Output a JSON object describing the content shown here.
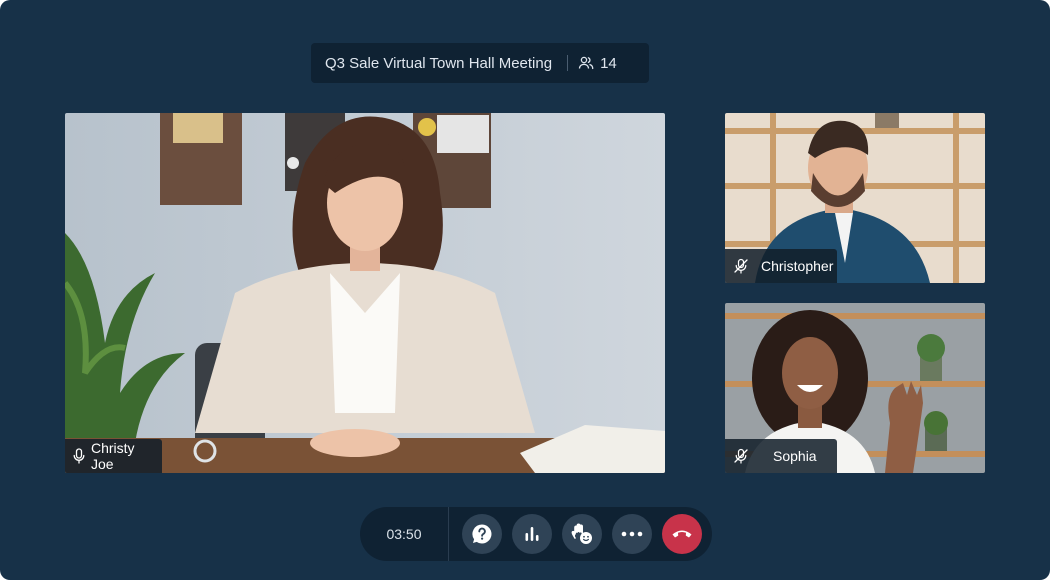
{
  "meeting": {
    "title": "Q3 Sale Virtual Town Hall Meeting",
    "participant_count": "14"
  },
  "participants": {
    "main": {
      "name": "Christy Joe",
      "mic": "on"
    },
    "side": [
      {
        "name": "Christopher",
        "mic": "muted"
      },
      {
        "name": "Sophia",
        "mic": "muted"
      }
    ]
  },
  "controls": {
    "timer": "03:50",
    "buttons": [
      "help-icon",
      "poll-icon",
      "raise-hand-icon",
      "more-icon",
      "end-call-icon"
    ]
  },
  "colors": {
    "background": "#173148",
    "panel": "#0f2233",
    "button": "#2f4356",
    "end_call": "#c8334a"
  }
}
